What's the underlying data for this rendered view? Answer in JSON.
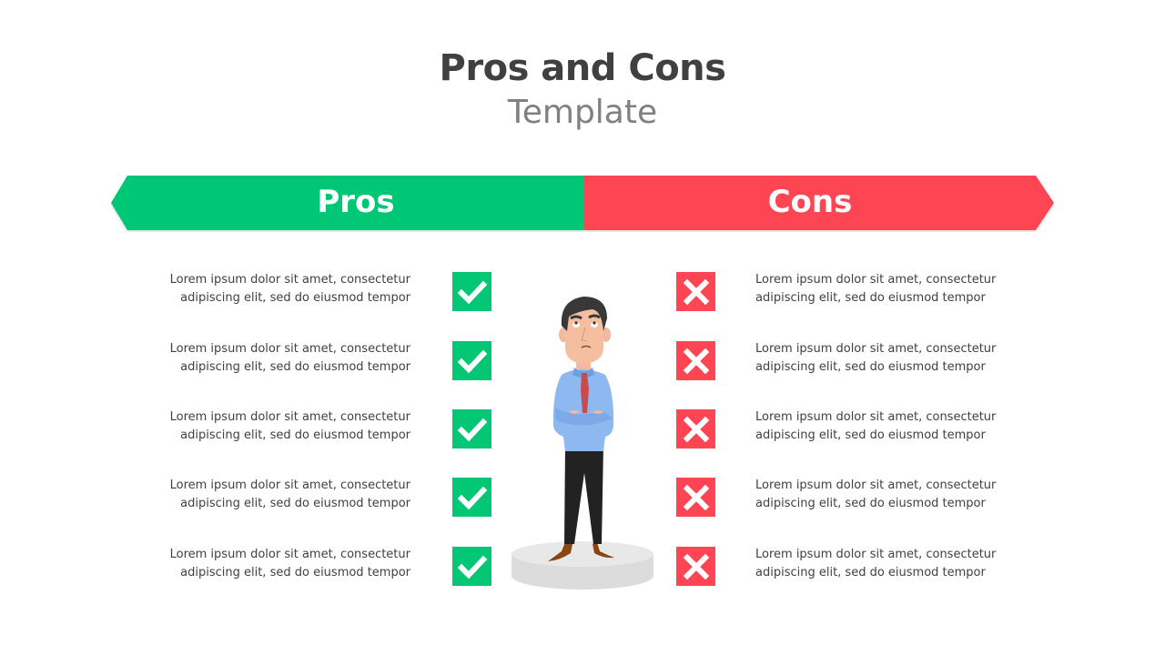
{
  "header": {
    "title": "Pros and Cons",
    "subtitle": "Template"
  },
  "colors": {
    "pros": "#03C775",
    "cons": "#FE4553",
    "title": "#404040",
    "subtitle": "#808080",
    "body_text": "#404040"
  },
  "pros": {
    "label": "Pros",
    "icon": "checkmark-icon",
    "items": [
      {
        "line1": "Lorem ipsum dolor sit amet, consectetur",
        "line2": "adipiscing elit, sed do eiusmod  tempor"
      },
      {
        "line1": "Lorem ipsum dolor sit amet, consectetur",
        "line2": "adipiscing elit, sed do eiusmod  tempor"
      },
      {
        "line1": "Lorem ipsum dolor sit amet, consectetur",
        "line2": "adipiscing elit, sed do eiusmod  tempor"
      },
      {
        "line1": "Lorem ipsum dolor sit amet, consectetur",
        "line2": "adipiscing elit, sed do eiusmod  tempor"
      },
      {
        "line1": "Lorem ipsum dolor sit amet, consectetur",
        "line2": "adipiscing elit, sed do eiusmod  tempor"
      }
    ]
  },
  "cons": {
    "label": "Cons",
    "icon": "cross-icon",
    "items": [
      {
        "line1": "Lorem ipsum dolor sit amet, consectetur",
        "line2": "adipiscing elit, sed do eiusmod  tempor"
      },
      {
        "line1": "Lorem ipsum dolor sit amet, consectetur",
        "line2": "adipiscing elit, sed do eiusmod  tempor"
      },
      {
        "line1": "Lorem ipsum dolor sit amet, consectetur",
        "line2": "adipiscing elit, sed do eiusmod  tempor"
      },
      {
        "line1": "Lorem ipsum dolor sit amet, consectetur",
        "line2": "adipiscing elit, sed do eiusmod  tempor"
      },
      {
        "line1": "Lorem ipsum dolor sit amet, consectetur",
        "line2": "adipiscing elit, sed do eiusmod  tempor"
      }
    ]
  },
  "illustration": {
    "subject": "businessman-thinking-on-pedestal"
  }
}
